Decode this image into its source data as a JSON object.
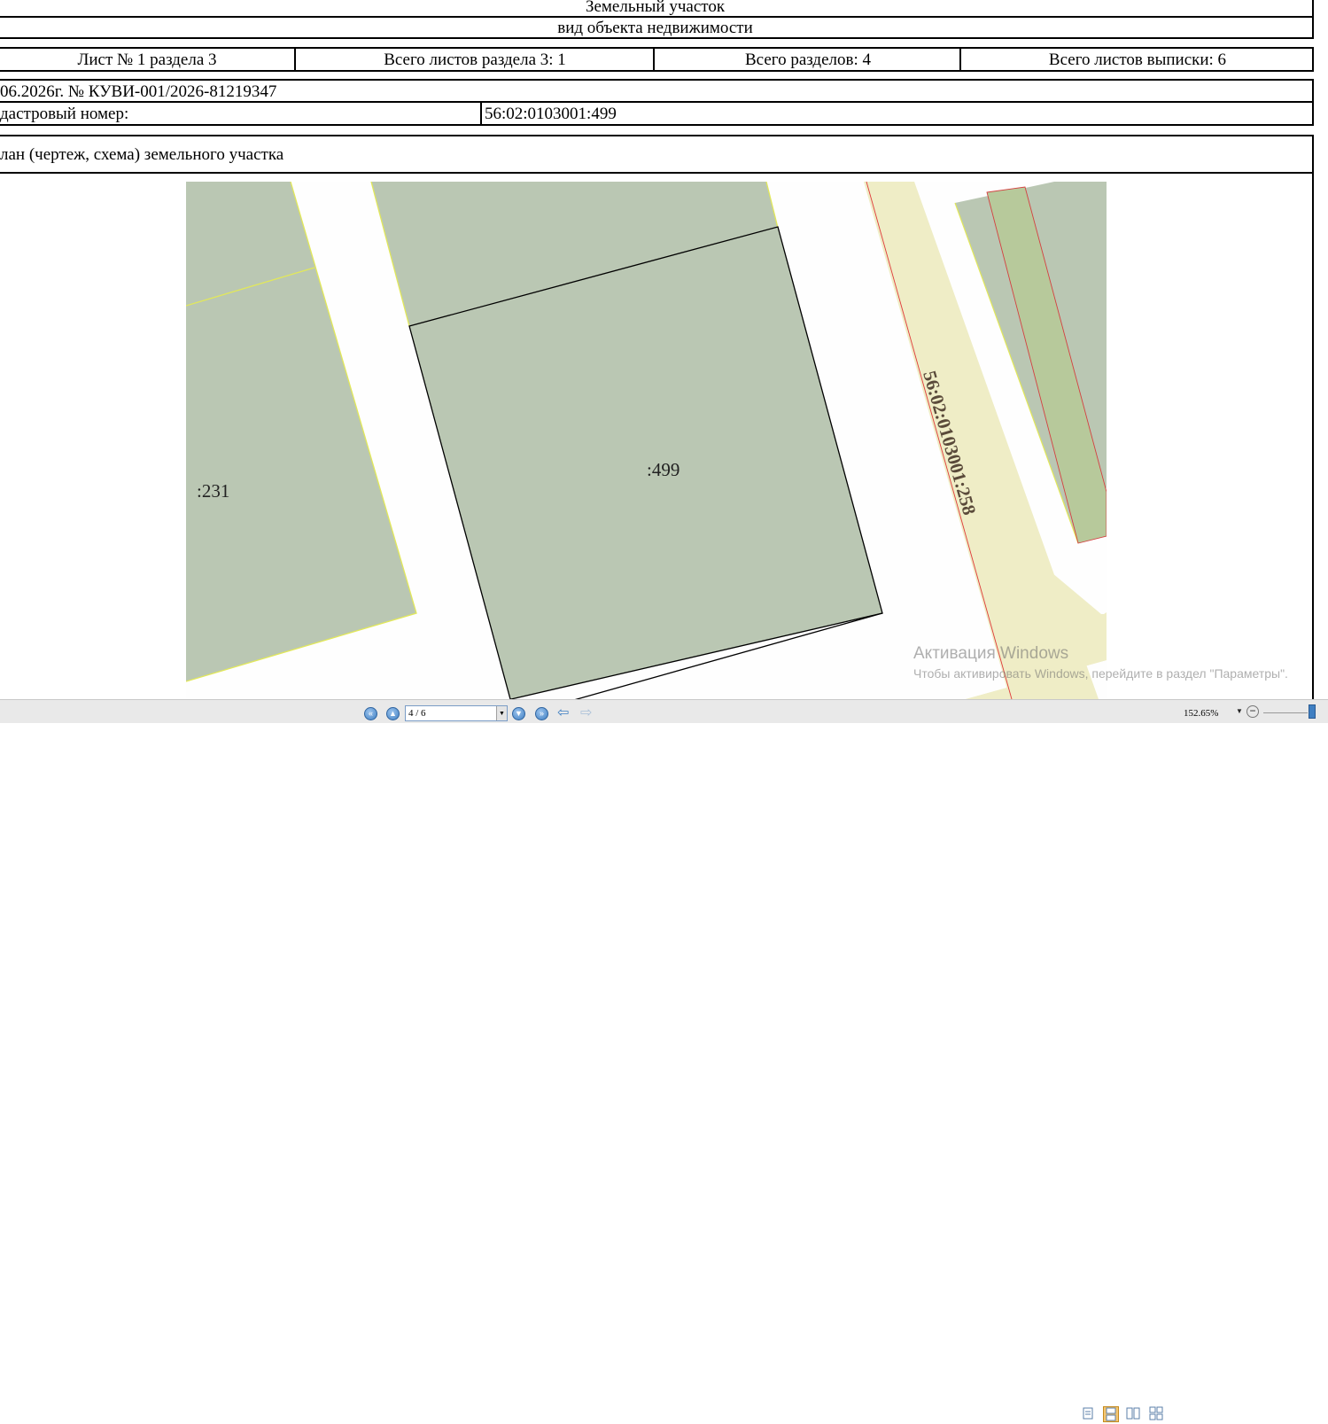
{
  "document": {
    "object_title": "Земельный участок",
    "object_subtitle": "вид объекта недвижимости",
    "sheet_info": [
      "Лист № 1 раздела 3",
      "Всего листов раздела 3: 1",
      "Всего разделов: 4",
      "Всего листов выписки: 6"
    ],
    "date_and_number": "06.2026г. № КУВИ-001/2026-81219347",
    "cadastral_label": "дастровый номер:",
    "cadastral_value": "56:02:0103001:499",
    "plan_title": "лан (чертеж, схема) земельного участка"
  },
  "map": {
    "label_main": ":499",
    "label_left": ":231",
    "label_road": "56:02:0103001:258",
    "colors": {
      "parcel_fill": "#bac7b3",
      "road_fill": "#efedc6",
      "green_strip": "#b7c99b",
      "parcel_border": "#000000",
      "neighbor_border": "#e2e85a",
      "red_line": "#e03a3a"
    }
  },
  "toolbar": {
    "page_value": "4 / 6",
    "zoom_value": "152.65%",
    "icons": [
      "first-page-icon",
      "prev-page-icon",
      "next-page-icon",
      "last-page-icon",
      "back-icon",
      "forward-icon",
      "single-page-view-icon",
      "continuous-view-icon",
      "two-page-view-icon",
      "thumbnails-view-icon",
      "zoom-out-icon",
      "zoom-slider"
    ]
  },
  "watermark": {
    "line1": "Активация Windows",
    "line2": "Чтобы активировать Windows, перейдите в раздел \"Параметры\"."
  }
}
